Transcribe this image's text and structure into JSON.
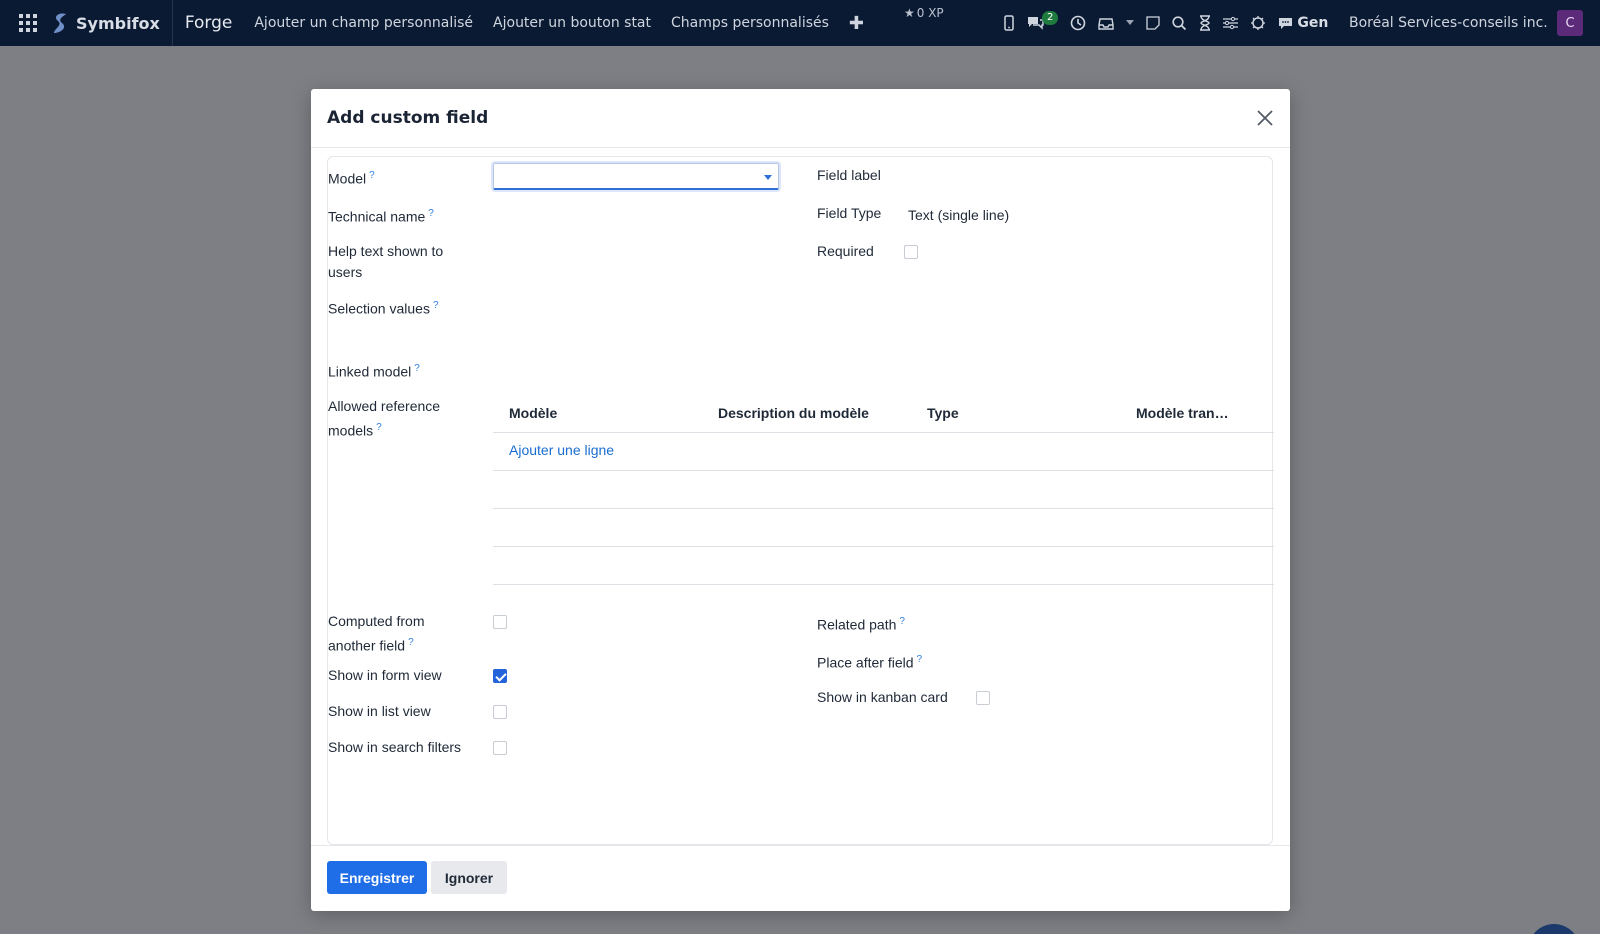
{
  "navbar": {
    "brand": "Symbifox",
    "app_name": "Forge",
    "menu": [
      "Ajouter un champ personnalisé",
      "Ajouter un bouton stat",
      "Champs personnalisés"
    ],
    "xp": "0 XP",
    "messages_count": "2",
    "gen_label": "Gen",
    "company": "Boréal Services-conseils inc.",
    "avatar_letter": "C"
  },
  "modal": {
    "title": "Add custom field",
    "left_fields": {
      "model": "Model",
      "technical_name": "Technical name",
      "help_text": "Help text shown to users",
      "selection_values": "Selection values",
      "linked_model": "Linked model",
      "allowed_reference_models": "Allowed reference models",
      "computed": "Computed from another field",
      "show_form": "Show in form view",
      "show_list": "Show in list view",
      "show_search": "Show in search filters"
    },
    "right_fields": {
      "field_label": "Field label",
      "field_type": "Field Type",
      "field_type_value": "Text (single line)",
      "required": "Required",
      "related_path": "Related path",
      "place_after": "Place after field",
      "show_kanban": "Show in kanban card"
    },
    "checkboxes": {
      "required": false,
      "computed": false,
      "show_form": true,
      "show_list": false,
      "show_search": false,
      "show_kanban": false
    },
    "ref_table": {
      "columns": [
        "Modèle",
        "Description du modèle",
        "Type",
        "Modèle tran…"
      ],
      "add_line": "Ajouter une ligne"
    },
    "footer": {
      "save": "Enregistrer",
      "discard": "Ignorer"
    }
  },
  "colors": {
    "navbar_bg": "#0b1a33",
    "primary": "#1f6ee8",
    "link": "#1a6dd1",
    "backdrop": "#7d7f84"
  }
}
